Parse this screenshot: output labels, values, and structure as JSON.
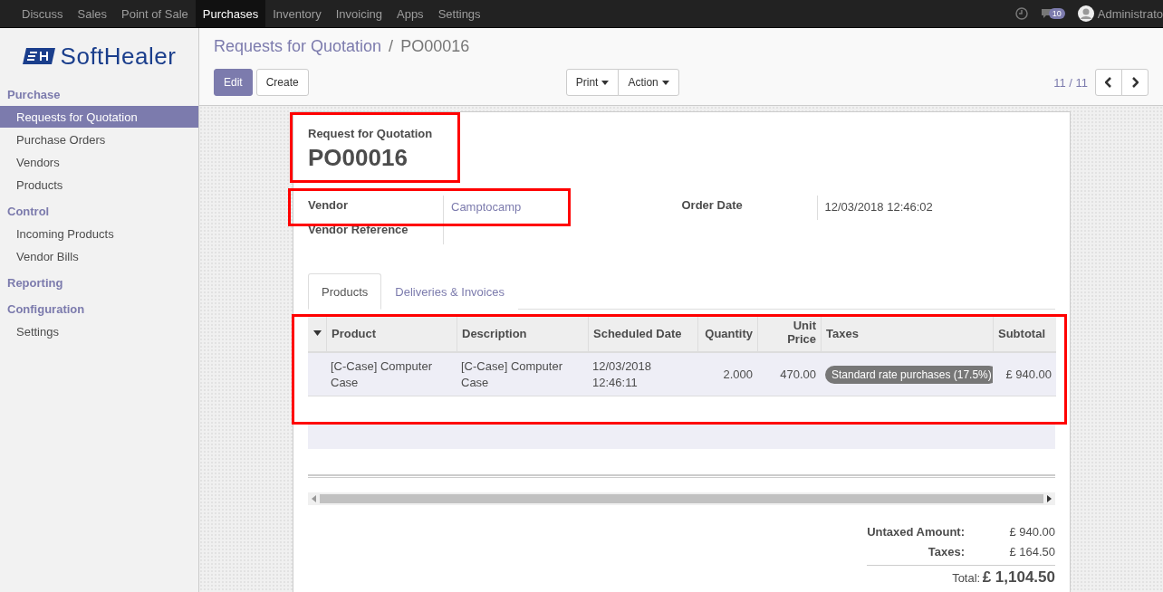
{
  "top_menu": [
    {
      "label": "Discuss",
      "selected": false
    },
    {
      "label": "Sales",
      "selected": false
    },
    {
      "label": "Point of Sale",
      "selected": false
    },
    {
      "label": "Purchases",
      "selected": true
    },
    {
      "label": "Inventory",
      "selected": false
    },
    {
      "label": "Invoicing",
      "selected": false
    },
    {
      "label": "Apps",
      "selected": false
    },
    {
      "label": "Settings",
      "selected": false
    }
  ],
  "systray": {
    "message_count": "10",
    "user": "Administrato"
  },
  "logo": {
    "text": "SoftHealer"
  },
  "sidebar": [
    {
      "kind": "header",
      "label": "Purchase"
    },
    {
      "kind": "item",
      "label": "Requests for Quotation",
      "selected": true
    },
    {
      "kind": "item",
      "label": "Purchase Orders",
      "selected": false
    },
    {
      "kind": "item",
      "label": "Vendors",
      "selected": false
    },
    {
      "kind": "item",
      "label": "Products",
      "selected": false
    },
    {
      "kind": "header",
      "label": "Control"
    },
    {
      "kind": "item",
      "label": "Incoming Products",
      "selected": false
    },
    {
      "kind": "item",
      "label": "Vendor Bills",
      "selected": false
    },
    {
      "kind": "header",
      "label": "Reporting"
    },
    {
      "kind": "header",
      "label": "Configuration"
    },
    {
      "kind": "item",
      "label": "Settings",
      "selected": false
    }
  ],
  "breadcrumb": [
    "Requests for Quotation",
    "/",
    "PO00016"
  ],
  "buttons": {
    "edit": "Edit",
    "create": "Create",
    "print": "Print",
    "action": "Action"
  },
  "pager": {
    "value": "11",
    "separator": "/",
    "limit": "11"
  },
  "form": {
    "subtitle": "Request for Quotation",
    "name": "PO00016",
    "fields": [
      {
        "label": "Vendor",
        "value": "Camptocamp"
      },
      {
        "label": "Vendor Reference"
      }
    ],
    "right_fields": [
      {
        "label": "Order Date",
        "value": "12/03/2018 12:46:02"
      }
    ],
    "tabs": [
      {
        "label": "Products",
        "selected": true
      },
      {
        "label": "Deliveries & Invoices",
        "selected": false
      }
    ],
    "table": {
      "columns": [
        "Product",
        "Description",
        "Scheduled Date",
        "Quantity",
        "Unit Price",
        "Taxes",
        "Subtotal"
      ],
      "rows": [
        {
          "product": "[C-Case] Computer Case",
          "description": "[C-Case] Computer Case",
          "date": "12/03/2018 12:46:11",
          "quantity": "2.000",
          "price": "470.00",
          "tax": "Standard rate purchases (17.5%)",
          "subtotal": "£ 940.00"
        }
      ]
    },
    "totals": [
      {
        "label": "Untaxed Amount:",
        "value": "£ 940.00"
      },
      {
        "label": "Taxes:",
        "value": "£ 164.50"
      }
    ],
    "total": {
      "label": "Total:",
      "value": "£ 1,104.50"
    }
  }
}
